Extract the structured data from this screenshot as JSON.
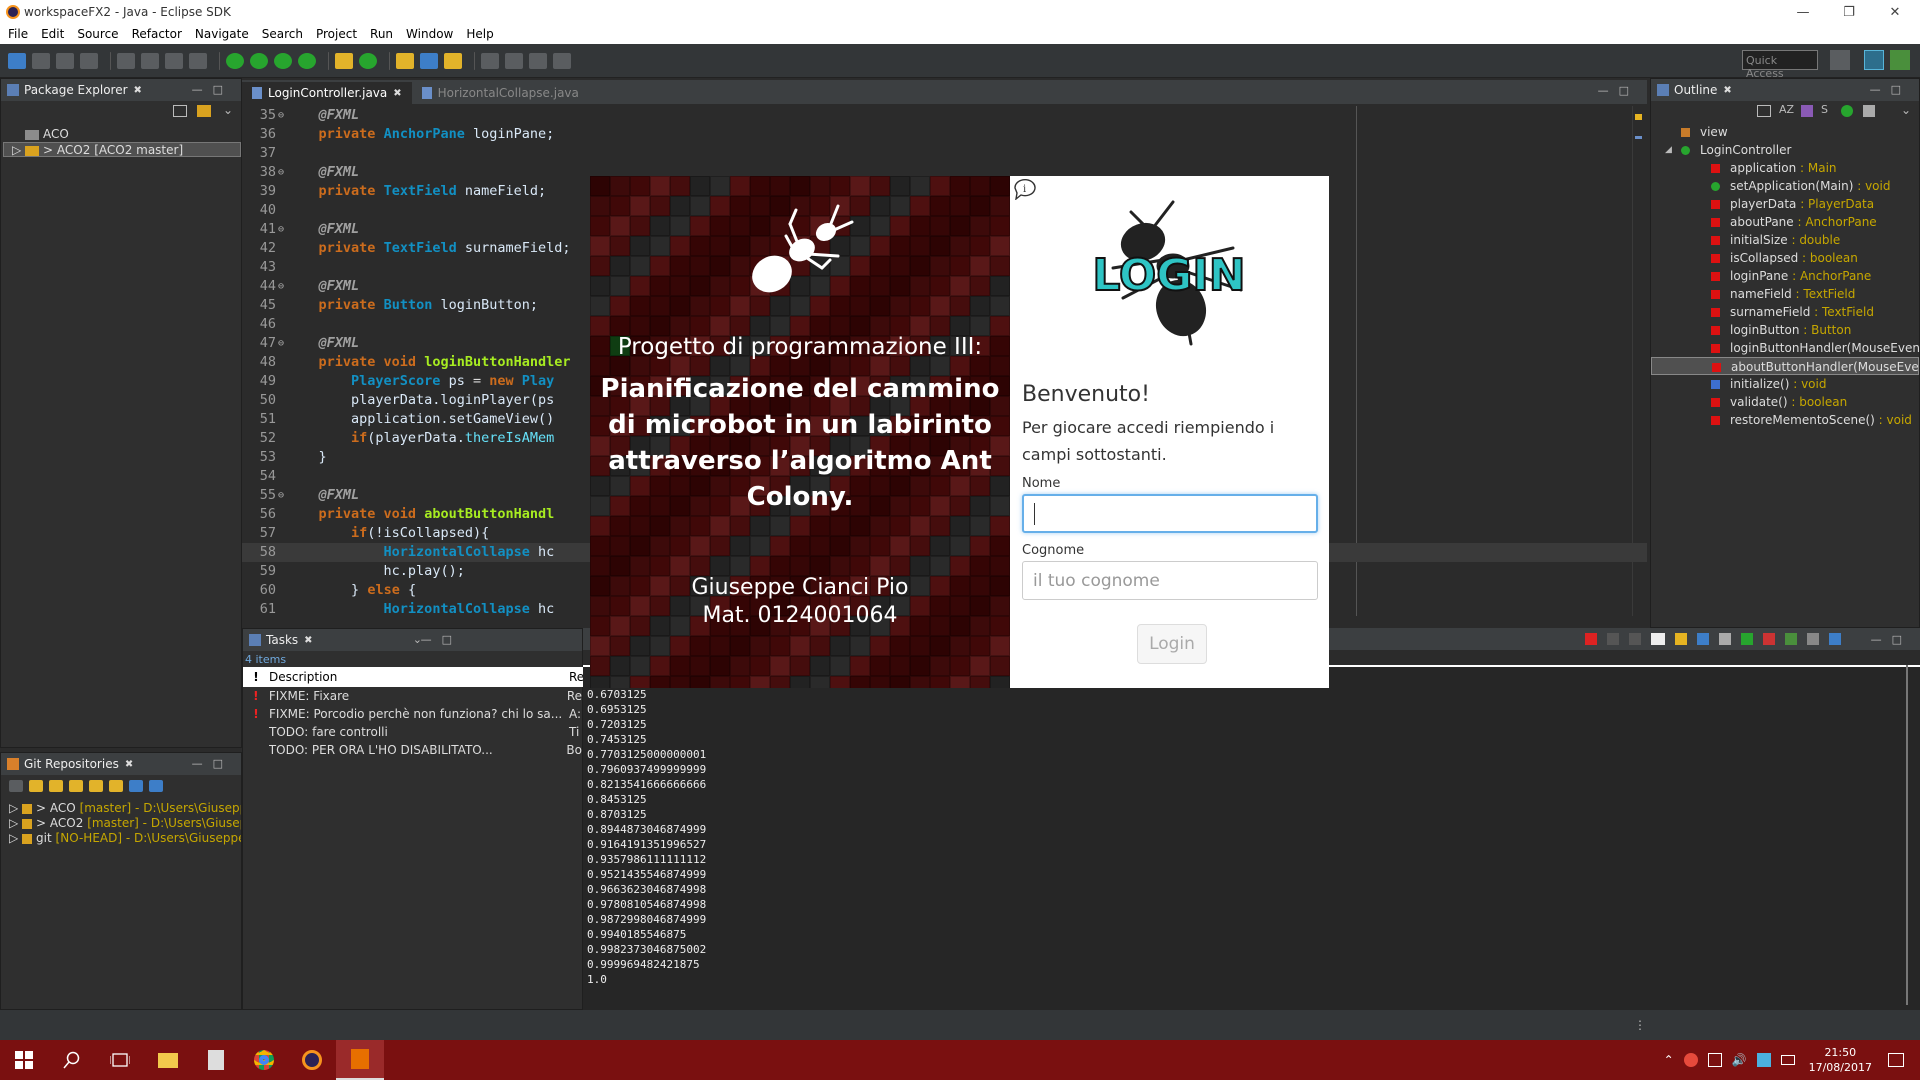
{
  "window": {
    "title": "workspaceFX2 - Java - Eclipse SDK"
  },
  "menu": [
    "File",
    "Edit",
    "Source",
    "Refactor",
    "Navigate",
    "Search",
    "Project",
    "Run",
    "Window",
    "Help"
  ],
  "toolbar": {
    "quick_access": "Quick Access"
  },
  "package_explorer": {
    "tab": "Package Explorer",
    "items": [
      {
        "label": "ACO"
      },
      {
        "label": "> ACO2 [ACO2 master]"
      }
    ]
  },
  "git_repositories": {
    "tab": "Git Repositories",
    "items": [
      {
        "label": "> ACO",
        "branch": "[master] - D:\\Users\\Giuseppe\\"
      },
      {
        "label": "> ACO2",
        "branch": "[master] - D:\\Users\\Giuseppe"
      },
      {
        "label": "git",
        "branch": "[NO-HEAD] - D:\\Users\\Giuseppe\\"
      }
    ]
  },
  "editor": {
    "tabs": [
      {
        "label": "LoginController.java",
        "active": true
      },
      {
        "label": "HorizontalCollapse.java",
        "active": false
      }
    ],
    "lines": [
      {
        "n": "35",
        "html": "    <span class=\"an\">@FXML</span>"
      },
      {
        "n": "36",
        "html": "    <span class=\"kw\">private</span> <span class=\"ty\">AnchorPane</span> <span class=\"id\">loginPane;</span>"
      },
      {
        "n": "37",
        "html": ""
      },
      {
        "n": "38",
        "html": "    <span class=\"an\">@FXML</span>"
      },
      {
        "n": "39",
        "html": "    <span class=\"kw\">private</span> <span class=\"ty\">TextField</span> <span class=\"id\">nameField;</span>"
      },
      {
        "n": "40",
        "html": ""
      },
      {
        "n": "41",
        "html": "    <span class=\"an\">@FXML</span>"
      },
      {
        "n": "42",
        "html": "    <span class=\"kw\">private</span> <span class=\"ty\">TextField</span> <span class=\"id\">surnameField;</span>"
      },
      {
        "n": "43",
        "html": ""
      },
      {
        "n": "44",
        "html": "    <span class=\"an\">@FXML</span>"
      },
      {
        "n": "45",
        "html": "    <span class=\"kw\">private</span> <span class=\"ty\">Button</span> <span class=\"id\">loginButton;</span>"
      },
      {
        "n": "46",
        "html": ""
      },
      {
        "n": "47",
        "html": "    <span class=\"an\">@FXML</span>"
      },
      {
        "n": "48",
        "html": "    <span class=\"kw\">private void</span> <span class=\"fn\">loginButtonHandler</span>"
      },
      {
        "n": "49",
        "html": "        <span class=\"ty\">PlayerScore</span> <span class=\"id\">ps</span> = <span class=\"kw\">new</span> <span class=\"ty\">Play</span>"
      },
      {
        "n": "50",
        "html": "        <span class=\"id\">playerData.loginPlayer(ps</span>"
      },
      {
        "n": "51",
        "html": "        <span class=\"id\">application.setGameView()</span>"
      },
      {
        "n": "52",
        "html": "        <span class=\"kw\">if</span><span class=\"id\">(playerData.</span><span class=\"fld\">thereIsAMem</span>"
      },
      {
        "n": "53",
        "html": "    <span class=\"id\">}</span>"
      },
      {
        "n": "54",
        "html": ""
      },
      {
        "n": "55",
        "html": "    <span class=\"an\">@FXML</span>"
      },
      {
        "n": "56",
        "html": "    <span class=\"kw\">private void</span> <span class=\"fn\">aboutButtonHandl</span>"
      },
      {
        "n": "57",
        "html": "        <span class=\"kw\">if</span><span class=\"id\">(!isCollapsed){</span>"
      },
      {
        "n": "58",
        "html": "            <span class=\"ty\">HorizontalCollapse</span> <span class=\"id\">hc</span>"
      },
      {
        "n": "59",
        "html": "            <span class=\"id\">hc.play();</span>"
      },
      {
        "n": "60",
        "html": "        <span class=\"id\">}</span> <span class=\"kw\">else</span> <span class=\"id\">{</span>"
      },
      {
        "n": "61",
        "html": "            <span class=\"ty\">HorizontalCollapse</span> <span class=\"id\">hc</span>"
      }
    ]
  },
  "outline": {
    "tab": "Outline",
    "items": [
      {
        "label": "view",
        "type": "",
        "indent": 1,
        "marker": "pkg"
      },
      {
        "label": "LoginController",
        "type": "",
        "indent": 1,
        "marker": "class"
      },
      {
        "label": "application",
        "type": " : Main",
        "indent": 2,
        "marker": "red"
      },
      {
        "label": "setApplication(Main)",
        "type": " : void",
        "indent": 2,
        "marker": "green"
      },
      {
        "label": "playerData",
        "type": " : PlayerData",
        "indent": 2,
        "marker": "red"
      },
      {
        "label": "aboutPane",
        "type": " : AnchorPane",
        "indent": 2,
        "marker": "red"
      },
      {
        "label": "initialSize",
        "type": " : double",
        "indent": 2,
        "marker": "red"
      },
      {
        "label": "isCollapsed",
        "type": " : boolean",
        "indent": 2,
        "marker": "red"
      },
      {
        "label": "loginPane",
        "type": " : AnchorPane",
        "indent": 2,
        "marker": "red"
      },
      {
        "label": "nameField",
        "type": " : TextField",
        "indent": 2,
        "marker": "red"
      },
      {
        "label": "surnameField",
        "type": " : TextField",
        "indent": 2,
        "marker": "red"
      },
      {
        "label": "loginButton",
        "type": " : Button",
        "indent": 2,
        "marker": "red"
      },
      {
        "label": "loginButtonHandler(MouseEvent)",
        "type": " :",
        "indent": 2,
        "marker": "red"
      },
      {
        "label": "aboutButtonHandler(MouseEvent)",
        "type": "",
        "indent": 2,
        "marker": "red"
      },
      {
        "label": "initialize()",
        "type": " : void",
        "indent": 2,
        "marker": "blue"
      },
      {
        "label": "validate()",
        "type": " : boolean",
        "indent": 2,
        "marker": "red"
      },
      {
        "label": "restoreMementoScene()",
        "type": " : void",
        "indent": 2,
        "marker": "red"
      }
    ]
  },
  "tasks": {
    "tab": "Tasks",
    "count": "4 items",
    "col_desc": "Description",
    "col_res": "Re",
    "items": [
      {
        "desc": "FIXME: Fixare",
        "res": "Re",
        "flag": "!"
      },
      {
        "desc": "FIXME: Porcodio perchè non funziona? chi lo sa...",
        "res": "A:",
        "flag": "!"
      },
      {
        "desc": "TODO: fare controlli",
        "res": "Ti",
        "flag": ""
      },
      {
        "desc": "TODO: PER ORA L'HO DISABILITATO...",
        "res": "Bo",
        "flag": ""
      }
    ]
  },
  "console": {
    "lines": [
      "0.6703125",
      "0.6953125",
      "0.7203125",
      "0.7453125",
      "0.7703125000000001",
      "0.7960937499999999",
      "0.8213541666666666",
      "0.8453125",
      "0.8703125",
      "0.8944873046874999",
      "0.9164191351996527",
      "0.9357986111111112",
      "0.9521435546874999",
      "0.9663623046874998",
      "0.9780810546874998",
      "0.9872998046874999",
      "0.9940185546875",
      "0.9982373046875002",
      "0.999969482421875",
      "1.0"
    ]
  },
  "modal": {
    "subtitle": "Progetto di programmazione III:",
    "title": "Pianificazione del cammino di microbot in un labirinto attraverso l’algoritmo Ant Colony.",
    "author": "Giuseppe Cianci Pio",
    "matricola": "Mat. 0124001064",
    "login_logo_text": "LOGIN",
    "welcome": "Benvenuto!",
    "welcome_sub": "Per giocare accedi riempiendo i campi sottostanti.",
    "name_label": "Nome",
    "name_value": "",
    "surname_label": "Cognome",
    "surname_placeholder": "il tuo cognome",
    "login_button": "Login"
  },
  "taskbar": {
    "time": "21:50",
    "date": "17/08/2017"
  },
  "colors": {
    "taskbar": "#7a1010",
    "modal_left_bg": "#6b0a0a",
    "login_logo_text": "#2ec4c4",
    "input_focus": "#66afe9"
  }
}
